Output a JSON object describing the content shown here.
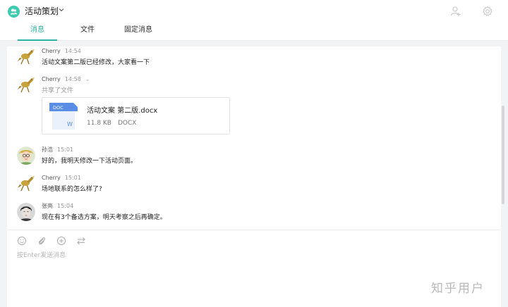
{
  "header": {
    "title": "活动策划",
    "icons": [
      "group-icon",
      "chevron-down-icon",
      "add-member-icon",
      "gear-icon"
    ],
    "accent": "#2bb5a0"
  },
  "tabs": [
    {
      "label": "消息",
      "active": true
    },
    {
      "label": "文件",
      "active": false
    },
    {
      "label": "固定消息",
      "active": false
    }
  ],
  "messages": [
    {
      "sender": "Cherry",
      "time": "14:54",
      "text": "活动文案第二版已经修改，大家看一下"
    },
    {
      "sender": "Cherry",
      "time": "14:58",
      "sub": "共享了文件",
      "file": {
        "icon_label": "DOC",
        "icon_letter": "W",
        "name": "活动文案 第二版.docx",
        "size": "11.8 KB",
        "type": "DOCX"
      }
    },
    {
      "sender": "孙浩",
      "time": "15:01",
      "text": "好的，我明天修改一下活动页面。"
    },
    {
      "sender": "Cherry",
      "time": "15:01",
      "text": "场地联系的怎么样了?"
    },
    {
      "sender": "张亮",
      "time": "15:04",
      "text": "现在有3个备选方案，明天考察之后再确定。"
    }
  ],
  "composer": {
    "placeholder": "按Enter发送消息",
    "tools": [
      "emoji-icon",
      "attachment-icon",
      "add-circle-icon",
      "swap-icon"
    ]
  },
  "watermark": "知乎用户"
}
